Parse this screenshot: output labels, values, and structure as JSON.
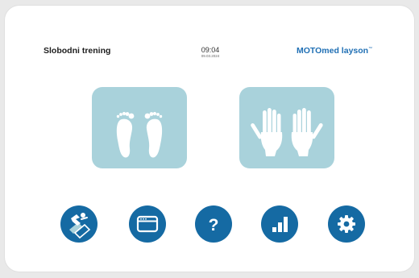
{
  "header": {
    "mode_title": "Slobodni trening",
    "time": "09:04",
    "date": "09.03.2024",
    "brand": "MOTOmed layson",
    "brand_mark": "™"
  },
  "modes": [
    {
      "id": "legs",
      "icon": "feet-icon"
    },
    {
      "id": "arms",
      "icon": "hands-icon"
    }
  ],
  "dock": [
    {
      "icon": "passive-training-icon"
    },
    {
      "icon": "program-window-icon"
    },
    {
      "icon": "help-question-icon",
      "glyph": "?"
    },
    {
      "icon": "statistics-bars-icon"
    },
    {
      "icon": "settings-gear-icon"
    }
  ],
  "colors": {
    "tile": "#a9d2db",
    "button": "#156aa3",
    "brand": "#1f6fb4",
    "text": "#1c1c1c",
    "background": "#e9e9e9"
  }
}
